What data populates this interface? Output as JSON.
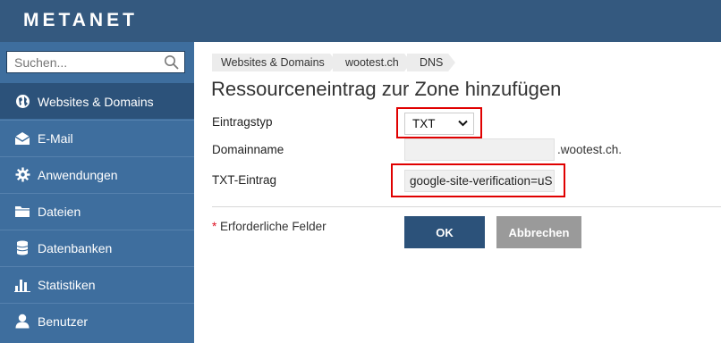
{
  "brand": {
    "logo_text": "METANET",
    "header_color": "#34597f",
    "sidebar_color": "#3e6e9e"
  },
  "search": {
    "placeholder": "Suchen..."
  },
  "sidebar": {
    "items": [
      {
        "label": "Websites & Domains",
        "icon": "globe-icon",
        "active": true
      },
      {
        "label": "E-Mail",
        "icon": "envelope-icon"
      },
      {
        "label": "Anwendungen",
        "icon": "gear-icon"
      },
      {
        "label": "Dateien",
        "icon": "folder-icon"
      },
      {
        "label": "Datenbanken",
        "icon": "database-icon"
      },
      {
        "label": "Statistiken",
        "icon": "bar-chart-icon"
      },
      {
        "label": "Benutzer",
        "icon": "user-icon"
      }
    ]
  },
  "breadcrumb": [
    "Websites & Domains",
    "wootest.ch",
    "DNS"
  ],
  "page": {
    "title": "Ressourceneintrag zur Zone hinzufügen"
  },
  "form": {
    "type_label": "Eintragstyp",
    "type_value": "TXT",
    "domain_label": "Domainname",
    "domain_value": "",
    "domain_suffix": ".wootest.ch.",
    "txt_label": "TXT-Eintrag",
    "txt_value": "google-site-verification=uS",
    "required_star": "*",
    "required_note": "Erforderliche Felder",
    "ok_label": "OK",
    "cancel_label": "Abbrechen"
  },
  "highlight_color": "#e00000"
}
